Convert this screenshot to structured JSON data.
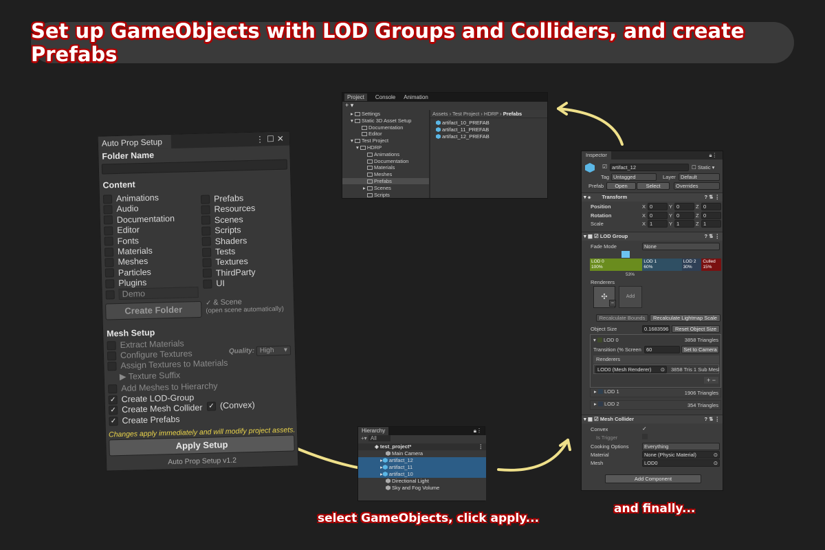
{
  "banner": {
    "title": "Set up GameObjects with LOD Groups and Colliders, and create Prefabs"
  },
  "captions": {
    "select": "select GameObjects, click apply...",
    "finally": "and finally..."
  },
  "auto_prop": {
    "tab_title": "Auto Prop Setup",
    "folder_name_label": "Folder Name",
    "folder_name_value": "",
    "content_label": "Content",
    "content_left": [
      {
        "label": "Animations",
        "checked": false
      },
      {
        "label": "Audio",
        "checked": false
      },
      {
        "label": "Documentation",
        "checked": false
      },
      {
        "label": "Editor",
        "checked": false
      },
      {
        "label": "Fonts",
        "checked": false
      },
      {
        "label": "Materials",
        "checked": false
      },
      {
        "label": "Meshes",
        "checked": false
      },
      {
        "label": "Particles",
        "checked": false
      },
      {
        "label": "Plugins",
        "checked": false
      }
    ],
    "content_right": [
      {
        "label": "Prefabs",
        "checked": false
      },
      {
        "label": "Resources",
        "checked": false
      },
      {
        "label": "Scenes",
        "checked": false
      },
      {
        "label": "Scripts",
        "checked": false
      },
      {
        "label": "Shaders",
        "checked": false
      },
      {
        "label": "Tests",
        "checked": false
      },
      {
        "label": "Textures",
        "checked": false
      },
      {
        "label": "ThirdParty",
        "checked": false
      },
      {
        "label": "UI",
        "checked": false
      }
    ],
    "demo_placeholder": "Demo",
    "create_folder_button": "Create Folder",
    "scene_label": "& Scene",
    "scene_hint": "(open scene automatically)",
    "mesh_setup_label": "Mesh Setup",
    "extract_materials": "Extract Materials",
    "configure_textures": "Configure Textures",
    "quality_label": "Quality:",
    "quality_value": "High",
    "assign_textures": "Assign Textures to Materials",
    "texture_suffix": "Texture Suffix",
    "add_meshes": "Add Meshes to Hierarchy",
    "create_lod": "Create LOD-Group",
    "create_collider": "Create Mesh Collider",
    "convex": "(Convex)",
    "create_prefabs": "Create Prefabs",
    "warning": "Changes apply immediately and will modify project assets.",
    "apply_button": "Apply Setup",
    "version": "Auto Prop Setup v1.2"
  },
  "project": {
    "tabs": [
      "Project",
      "Console",
      "Animation"
    ],
    "add_label": "+ ▾",
    "tree": [
      "Settings",
      "Static 3D Asset Setup",
      "Documentation",
      "Editor",
      "Test Project",
      "HDRP",
      "Animations",
      "Documentation",
      "Materials",
      "Meshes",
      "Prefabs",
      "Scenes",
      "Scripts"
    ],
    "breadcrumb": [
      "Assets",
      "Test Project",
      "HDRP"
    ],
    "breadcrumb_current": "Prefabs",
    "files": [
      "artifact_10_PREFAB",
      "artifact_11_PREFAB",
      "artifact_12_PREFAB"
    ]
  },
  "hierarchy": {
    "tab": "Hierarchy",
    "search_placeholder": "All",
    "scene": "test_project*",
    "rows": [
      "Main Camera",
      "artifact_12",
      "artifact_11",
      "artifact_10",
      "Directional Light",
      "Sky and Fog Volume"
    ]
  },
  "inspector": {
    "tab": "Inspector",
    "object_name": "artifact_12",
    "static_label": "Static",
    "tag_label": "Tag",
    "tag_value": "Untagged",
    "layer_label": "Layer",
    "layer_value": "Default",
    "prefab_label": "Prefab",
    "open_btn": "Open",
    "select_btn": "Select",
    "overrides": "Overrides",
    "transform": {
      "title": "Transform",
      "rows": [
        {
          "label": "Position",
          "x": "0",
          "y": "0",
          "z": "0"
        },
        {
          "label": "Rotation",
          "x": "0",
          "y": "0",
          "z": "0"
        },
        {
          "label": "Scale",
          "x": "1",
          "y": "1",
          "z": "1"
        }
      ]
    },
    "lod_group": {
      "title": "LOD Group",
      "fade_mode_label": "Fade Mode",
      "fade_mode_value": "None",
      "bars": [
        {
          "name": "LOD 0",
          "pct": "100%",
          "color": "#6a8c1e"
        },
        {
          "name": "LOD 1",
          "pct": "60%",
          "color": "#2f4f63"
        },
        {
          "name": "LOD 2",
          "pct": "30%",
          "color": "#2e3f55"
        },
        {
          "name": "Culled",
          "pct": "15%",
          "color": "#7a1010"
        }
      ],
      "cursor_pct": "53%",
      "renderers_label": "Renderers",
      "add_label": "Add",
      "recalc_bounds": "Recalculate Bounds",
      "recalc_lightmap": "Recalculate Lightmap Scale",
      "object_size_label": "Object Size",
      "object_size_value": "0.1683596",
      "reset_size": "Reset Object Size",
      "lod0_label": "LOD 0",
      "lod0_tris": "3858 Triangles",
      "transition_label": "Transition (% Screen",
      "transition_value": "60",
      "set_camera": "Set to Camera",
      "lod0_renderer": "LOD0 (Mesh Renderer)",
      "lod0_renderer_info": "3858 Tris 1 Sub Mesh",
      "lod1_label": "LOD 1",
      "lod1_tris": "1906 Triangles",
      "lod2_label": "LOD 2",
      "lod2_tris": "354 Triangles"
    },
    "mesh_collider": {
      "title": "Mesh Collider",
      "convex_label": "Convex",
      "is_trigger_label": "Is Trigger",
      "cooking_label": "Cooking Options",
      "cooking_value": "Everything",
      "material_label": "Material",
      "material_value": "None (Physic Material)",
      "mesh_label": "Mesh",
      "mesh_value": "LOD0"
    },
    "add_component": "Add Component"
  }
}
